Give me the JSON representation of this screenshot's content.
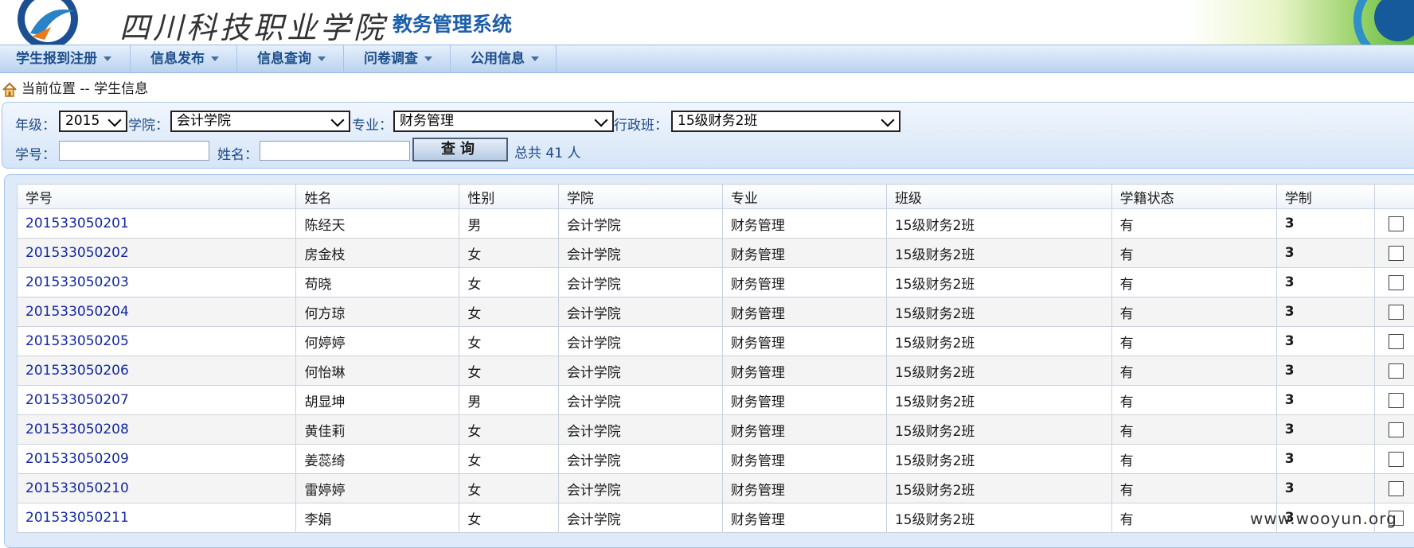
{
  "header": {
    "school_name": "四川科技职业学院",
    "system_name": "教务管理系统"
  },
  "nav": {
    "items": [
      "学生报到注册",
      "信息发布",
      "信息查询",
      "问卷调查",
      "公用信息"
    ]
  },
  "breadcrumb": {
    "text": "当前位置 -- 学生信息"
  },
  "filter": {
    "grade_label": "年级：",
    "grade_value": "2015",
    "college_label": "学院：",
    "college_value": "会计学院",
    "major_label": "专业：",
    "major_value": "财务管理",
    "class_label": "行政班：",
    "class_value": "15级财务2班",
    "student_id_label": "学号：",
    "student_id_value": "",
    "name_label": "姓名：",
    "name_value": "",
    "query_button": "查询",
    "total_text": "总共 41 人"
  },
  "table": {
    "columns": [
      "学号",
      "姓名",
      "性别",
      "学院",
      "专业",
      "班级",
      "学籍状态",
      "学制",
      ""
    ],
    "rows": [
      {
        "id": "201533050201",
        "name": "陈经天",
        "gender": "男",
        "college": "会计学院",
        "major": "财务管理",
        "class": "15级财务2班",
        "status": "有",
        "years": "3"
      },
      {
        "id": "201533050202",
        "name": "房金枝",
        "gender": "女",
        "college": "会计学院",
        "major": "财务管理",
        "class": "15级财务2班",
        "status": "有",
        "years": "3"
      },
      {
        "id": "201533050203",
        "name": "苟晓",
        "gender": "女",
        "college": "会计学院",
        "major": "财务管理",
        "class": "15级财务2班",
        "status": "有",
        "years": "3"
      },
      {
        "id": "201533050204",
        "name": "何方琼",
        "gender": "女",
        "college": "会计学院",
        "major": "财务管理",
        "class": "15级财务2班",
        "status": "有",
        "years": "3"
      },
      {
        "id": "201533050205",
        "name": "何婷婷",
        "gender": "女",
        "college": "会计学院",
        "major": "财务管理",
        "class": "15级财务2班",
        "status": "有",
        "years": "3"
      },
      {
        "id": "201533050206",
        "name": "何怡琳",
        "gender": "女",
        "college": "会计学院",
        "major": "财务管理",
        "class": "15级财务2班",
        "status": "有",
        "years": "3"
      },
      {
        "id": "201533050207",
        "name": "胡显坤",
        "gender": "男",
        "college": "会计学院",
        "major": "财务管理",
        "class": "15级财务2班",
        "status": "有",
        "years": "3"
      },
      {
        "id": "201533050208",
        "name": "黄佳莉",
        "gender": "女",
        "college": "会计学院",
        "major": "财务管理",
        "class": "15级财务2班",
        "status": "有",
        "years": "3"
      },
      {
        "id": "201533050209",
        "name": "姜蕊绮",
        "gender": "女",
        "college": "会计学院",
        "major": "财务管理",
        "class": "15级财务2班",
        "status": "有",
        "years": "3"
      },
      {
        "id": "201533050210",
        "name": "雷婷婷",
        "gender": "女",
        "college": "会计学院",
        "major": "财务管理",
        "class": "15级财务2班",
        "status": "有",
        "years": "3"
      },
      {
        "id": "201533050211",
        "name": "李娟",
        "gender": "女",
        "college": "会计学院",
        "major": "财务管理",
        "class": "15级财务2班",
        "status": "有",
        "years": "3"
      }
    ]
  },
  "watermark": "www.wooyun.org",
  "colors": {
    "accent": "#1d5fa8",
    "link": "#1428a0",
    "nav_text": "#1d4e8c",
    "panel_bg": "#d5e5f7"
  }
}
